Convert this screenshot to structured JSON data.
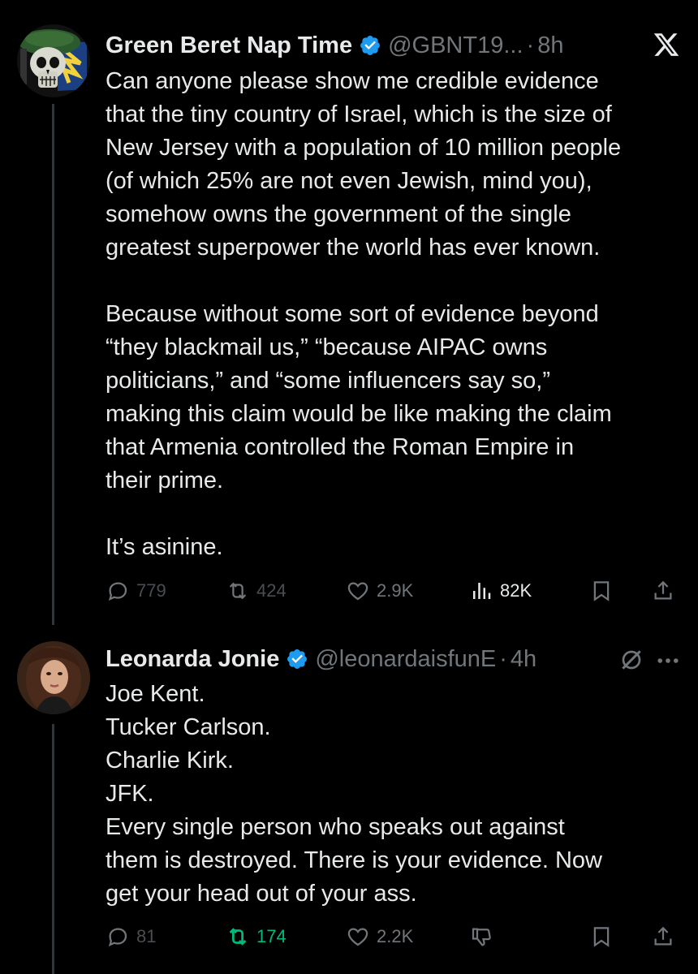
{
  "tweets": [
    {
      "author_name": "Green Beret Nap Time",
      "handle": "@GBNT19...",
      "separator": "·",
      "time": "8h",
      "avatar_icon": "skull-beret-avatar",
      "verified": true,
      "paragraphs": [
        [
          "Can anyone please show me credible evidence",
          "that the tiny country of Israel, which is the size of",
          "New Jersey with a population of 10 million people",
          "(of which 25% are not even Jewish, mind you),",
          "somehow owns the government of the single",
          "greatest superpower the world has ever known."
        ],
        [
          "Because without some sort of evidence beyond",
          "“they blackmail us,” “because AIPAC owns",
          "politicians,” and “some influencers say so,”",
          "making this claim would be like making the claim",
          "that Armenia controlled the Roman Empire in",
          "their prime."
        ],
        [
          "It’s asinine."
        ]
      ],
      "replies": "779",
      "reposts": "424",
      "likes": "2.9K",
      "views": "82K"
    },
    {
      "author_name": "Leonarda Jonie",
      "handle": "@leonardaisfunE",
      "separator": "·",
      "time": "4h",
      "avatar_icon": "woman-portrait-avatar",
      "verified": true,
      "lines": [
        "Joe Kent.",
        "Tucker Carlson.",
        "Charlie Kirk.",
        "JFK.",
        "Every single person who speaks out against",
        "them is destroyed. There is your evidence. Now",
        "get your head out of your ass."
      ],
      "replies": "81",
      "reposts": "174",
      "likes": "2.2K"
    }
  ],
  "colors": {
    "background": "#000000",
    "text": "#e7e9ea",
    "muted": "#71767b",
    "verified": "#1d9bf0",
    "repost_active": "#00ba7c",
    "thread_line": "#333639"
  }
}
